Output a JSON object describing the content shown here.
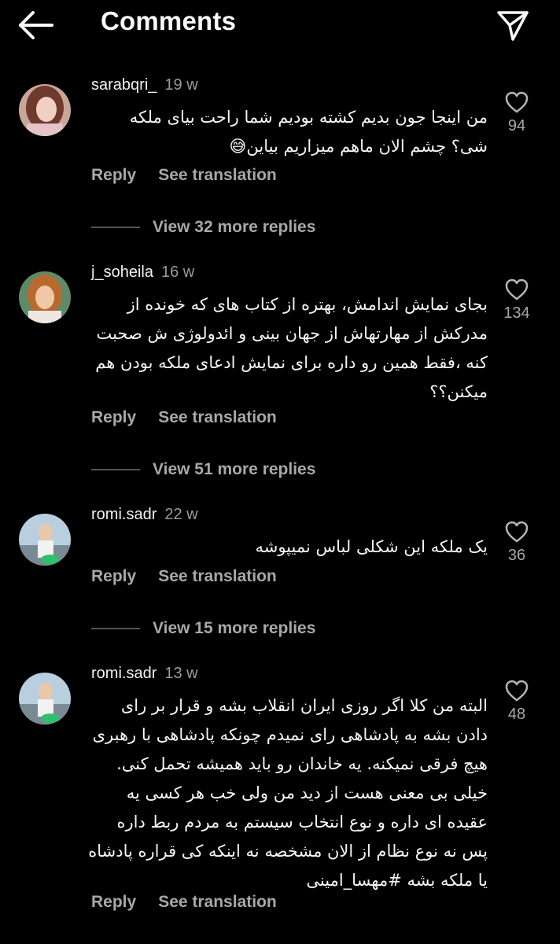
{
  "header": {
    "title": "Comments"
  },
  "comments": [
    {
      "username": "sarabqri_",
      "time": "19 w",
      "text": "من اینجا جون بدیم کشته بودیم شما راحت بیای ملکه شی؟ چشم الان ماهم میزاریم بیاین😅",
      "likes": "94",
      "reply": "Reply",
      "translate": "See translation"
    },
    {
      "username": "j_soheila",
      "time": "16 w",
      "text": "بجای نمایش اندامش، بهتره از کتاب های که خونده از مدرکش از مهارتهاش از جهان بینی و ائدولوژی ش صحبت کنه ،فقط همین رو داره برای نمایش ادعای ملکه بودن هم میکنن؟؟",
      "likes": "134",
      "reply": "Reply",
      "translate": "See translation"
    },
    {
      "username": "romi.sadr",
      "time": "22 w",
      "text": "یک ملکه این شکلی لباس نمیپوشه",
      "likes": "36",
      "reply": "Reply",
      "translate": "See translation"
    },
    {
      "username": "romi.sadr",
      "time": "13 w",
      "text": "البته من کلا اگر روزی ایران انقلاب بشه و قرار بر رای دادن بشه به پادشاهی رای نمیدم چونکه پادشاهی با رهبری هیچ فرقی نمیکنه. یه خاندان رو باید همیشه تحمل کنی. خیلی بی معنی هست از دید من ولی خب هر کسی یه عقیده ای داره و نوع انتخاب سیستم به مردم ربط داره پس نه نوع نظام از الان مشخصه نه اینکه کی قراره پادشاه یا ملکه بشه #مهسا_امینی",
      "likes": "48",
      "reply": "Reply",
      "translate": "See translation"
    }
  ],
  "more_replies": [
    {
      "label": "View 32 more replies"
    },
    {
      "label": "View 51 more replies"
    },
    {
      "label": "View 15 more replies"
    }
  ],
  "colors": {
    "background": "#000000",
    "text": "#f5f5f5",
    "secondary": "#a8a8a8"
  }
}
